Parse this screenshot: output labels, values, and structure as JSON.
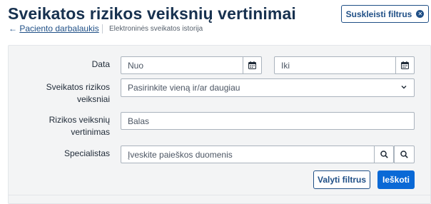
{
  "header": {
    "title": "Sveikatos rizikos veiksnių vertinimai",
    "collapse_button": "Suskleisti filtrus",
    "back_arrow": "←",
    "back_link": "Paciento darbalaukis",
    "breadcrumb": "Elektroninės sveikatos istorija"
  },
  "filters": {
    "date": {
      "label": "Data",
      "from_placeholder": "Nuo",
      "to_placeholder": "Iki"
    },
    "risk_factors": {
      "label_line1": "Sveikatos rizikos",
      "label_line2": "veiksniai",
      "placeholder": "Pasirinkite vieną ir/ar daugiau"
    },
    "risk_score": {
      "label_line1": "Rizikos veiksnių",
      "label_line2": "vertinimas",
      "placeholder": "Balas"
    },
    "specialist": {
      "label": "Specialistas",
      "placeholder": "Įveskite paieškos duomenis"
    }
  },
  "actions": {
    "clear": "Valyti filtrus",
    "search": "Ieškoti"
  },
  "icons": {
    "collapse": "close-circle-icon",
    "date": "calendar-icon",
    "dropdown": "chevron-down-icon",
    "search": "search-icon"
  },
  "colors": {
    "title": "#17314f",
    "link": "#1f4f86",
    "primary": "#0a69d6",
    "panel_bg": "#f3f4f5"
  }
}
